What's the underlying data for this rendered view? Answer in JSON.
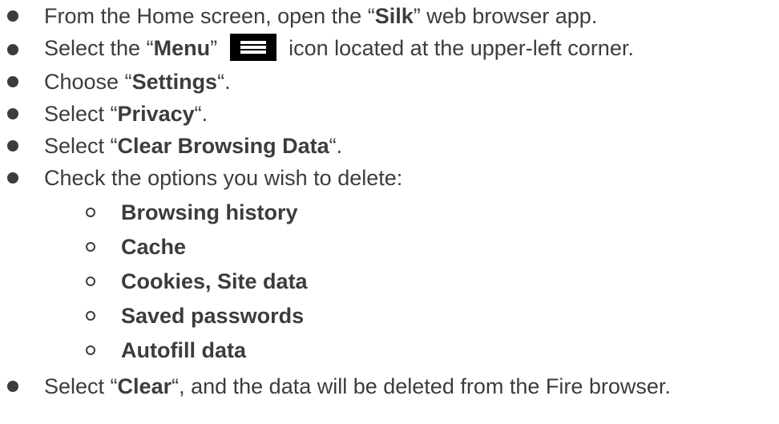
{
  "steps": [
    {
      "pre": "From the Home screen, open the “",
      "bold": "Silk",
      "post": "” web browser app."
    },
    {
      "pre": "Select the “",
      "bold": "Menu",
      "post_before_icon": "” ",
      "icon": "menu-icon",
      "post": " icon located at the upper-left corner."
    },
    {
      "pre": "Choose “",
      "bold": "Settings",
      "post": "“."
    },
    {
      "pre": "Select “",
      "bold": "Privacy",
      "post": "“."
    },
    {
      "pre": "Select “",
      "bold": "Clear Browsing Data",
      "post": "“."
    },
    {
      "text": "Check the options you wish to delete:"
    },
    {
      "pre": "Select “",
      "bold": "Clear",
      "post": "“, and the data will be deleted from the Fire browser."
    }
  ],
  "options": [
    "Browsing history",
    "Cache",
    "Cookies, Site data",
    "Saved passwords",
    "Autofill data"
  ]
}
